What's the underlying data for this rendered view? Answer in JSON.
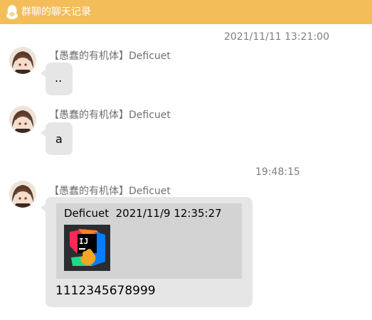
{
  "window": {
    "title": "群聊的聊天记录"
  },
  "colors": {
    "titlebar": "#f3bd59",
    "bubble": "#e6e6e6",
    "reply_box": "#d3d3d3"
  },
  "messages": [
    {
      "timestamp": "2021/11/11 13:21:00",
      "sender": "【愚蠢的有机体】Deficuet",
      "avatar": "avatar-icon",
      "text": ".."
    },
    {
      "sender": "【愚蠢的有机体】Deficuet",
      "avatar": "avatar-icon",
      "text": "a"
    },
    {
      "timestamp": "19:48:15",
      "sender": "【愚蠢的有机体】Deficuet",
      "avatar": "avatar-icon",
      "reply": {
        "author": "Deficuet",
        "time": "2021/11/9 12:35:27",
        "image_icon": "intellij-idea-icon"
      },
      "text": "1112345678999"
    }
  ]
}
